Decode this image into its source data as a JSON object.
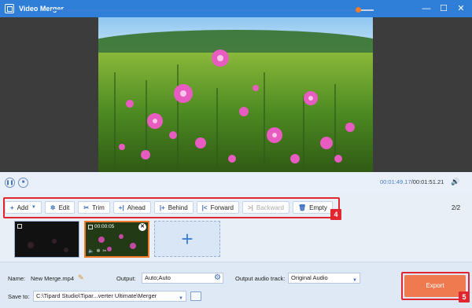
{
  "window": {
    "title": "Video Merger",
    "minimize": "—",
    "maximize": "☐",
    "close": "✕"
  },
  "player": {
    "pause_icon": "pause-icon",
    "stop_icon": "stop-icon",
    "progress": 0.95,
    "current_time": "00:01:49.17",
    "total_time": "/00:01:51.21"
  },
  "toolbar": {
    "add_label": "Add",
    "edit_label": "Edit",
    "trim_label": "Trim",
    "ahead_label": "Ahead",
    "behind_label": "Behind",
    "forward_label": "Forward",
    "backward_label": "Backward",
    "empty_label": "Empty",
    "badge": "4"
  },
  "page_count": "2/2",
  "clips": [
    {
      "duration": ""
    },
    {
      "duration": "00:00:05"
    }
  ],
  "bottom": {
    "name_label": "Name:",
    "name_value": "New Merge.mp4",
    "output_label": "Output:",
    "output_value": "Auto;Auto",
    "audio_label": "Output audio track:",
    "audio_value": "Original Audio",
    "save_label": "Save to:",
    "save_value": "C:\\Tipard Studio\\Tipar...verter Ultimate\\Merger"
  },
  "export": {
    "label": "Export",
    "badge": "5"
  },
  "colors": {
    "accent": "#2f7fd8",
    "export": "#ef7a50",
    "highlight": "#e0262e",
    "progress_knob": "#f27a2b"
  }
}
